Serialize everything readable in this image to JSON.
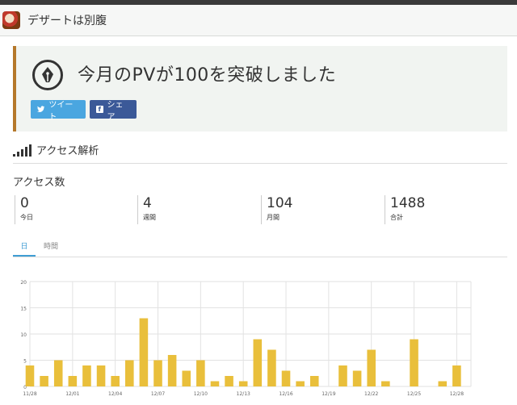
{
  "header": {
    "blog_title": "デザートは別腹"
  },
  "notice": {
    "message": "今月のPVが100を突破しました",
    "tweet_label": "ツイート",
    "share_label": "シェア"
  },
  "section": {
    "title": "アクセス解析"
  },
  "access": {
    "title": "アクセス数",
    "stats": [
      {
        "value": "0",
        "label": "今日"
      },
      {
        "value": "4",
        "label": "週間"
      },
      {
        "value": "104",
        "label": "月間"
      },
      {
        "value": "1488",
        "label": "合計"
      }
    ]
  },
  "tabs": {
    "day": "日",
    "hour": "時間"
  },
  "colors": {
    "bar": "#e9bf3b",
    "accent": "#3f9dd3",
    "notice_border": "#b5782b",
    "tweet": "#4aa6e0",
    "share": "#3b5998"
  },
  "chart_data": {
    "type": "bar",
    "ylim": [
      0,
      20
    ],
    "yticks": [
      0,
      5,
      10,
      15,
      20
    ],
    "categories": [
      "11/28",
      "11/29",
      "11/30",
      "12/01",
      "12/02",
      "12/03",
      "12/04",
      "12/05",
      "12/06",
      "12/07",
      "12/08",
      "12/09",
      "12/10",
      "12/11",
      "12/12",
      "12/13",
      "12/14",
      "12/15",
      "12/16",
      "12/17",
      "12/18",
      "12/19",
      "12/20",
      "12/21",
      "12/22",
      "12/23",
      "12/24",
      "12/25",
      "12/26",
      "12/27",
      "12/28"
    ],
    "values": [
      4,
      2,
      5,
      2,
      4,
      4,
      2,
      5,
      13,
      5,
      6,
      3,
      5,
      1,
      2,
      1,
      9,
      7,
      3,
      1,
      2,
      0,
      4,
      3,
      7,
      1,
      0,
      9,
      0,
      1,
      4
    ],
    "xtick_labels": [
      "11/28",
      "12/01",
      "12/04",
      "12/07",
      "12/10",
      "12/13",
      "12/16",
      "12/19",
      "12/22",
      "12/25",
      "12/28"
    ]
  }
}
